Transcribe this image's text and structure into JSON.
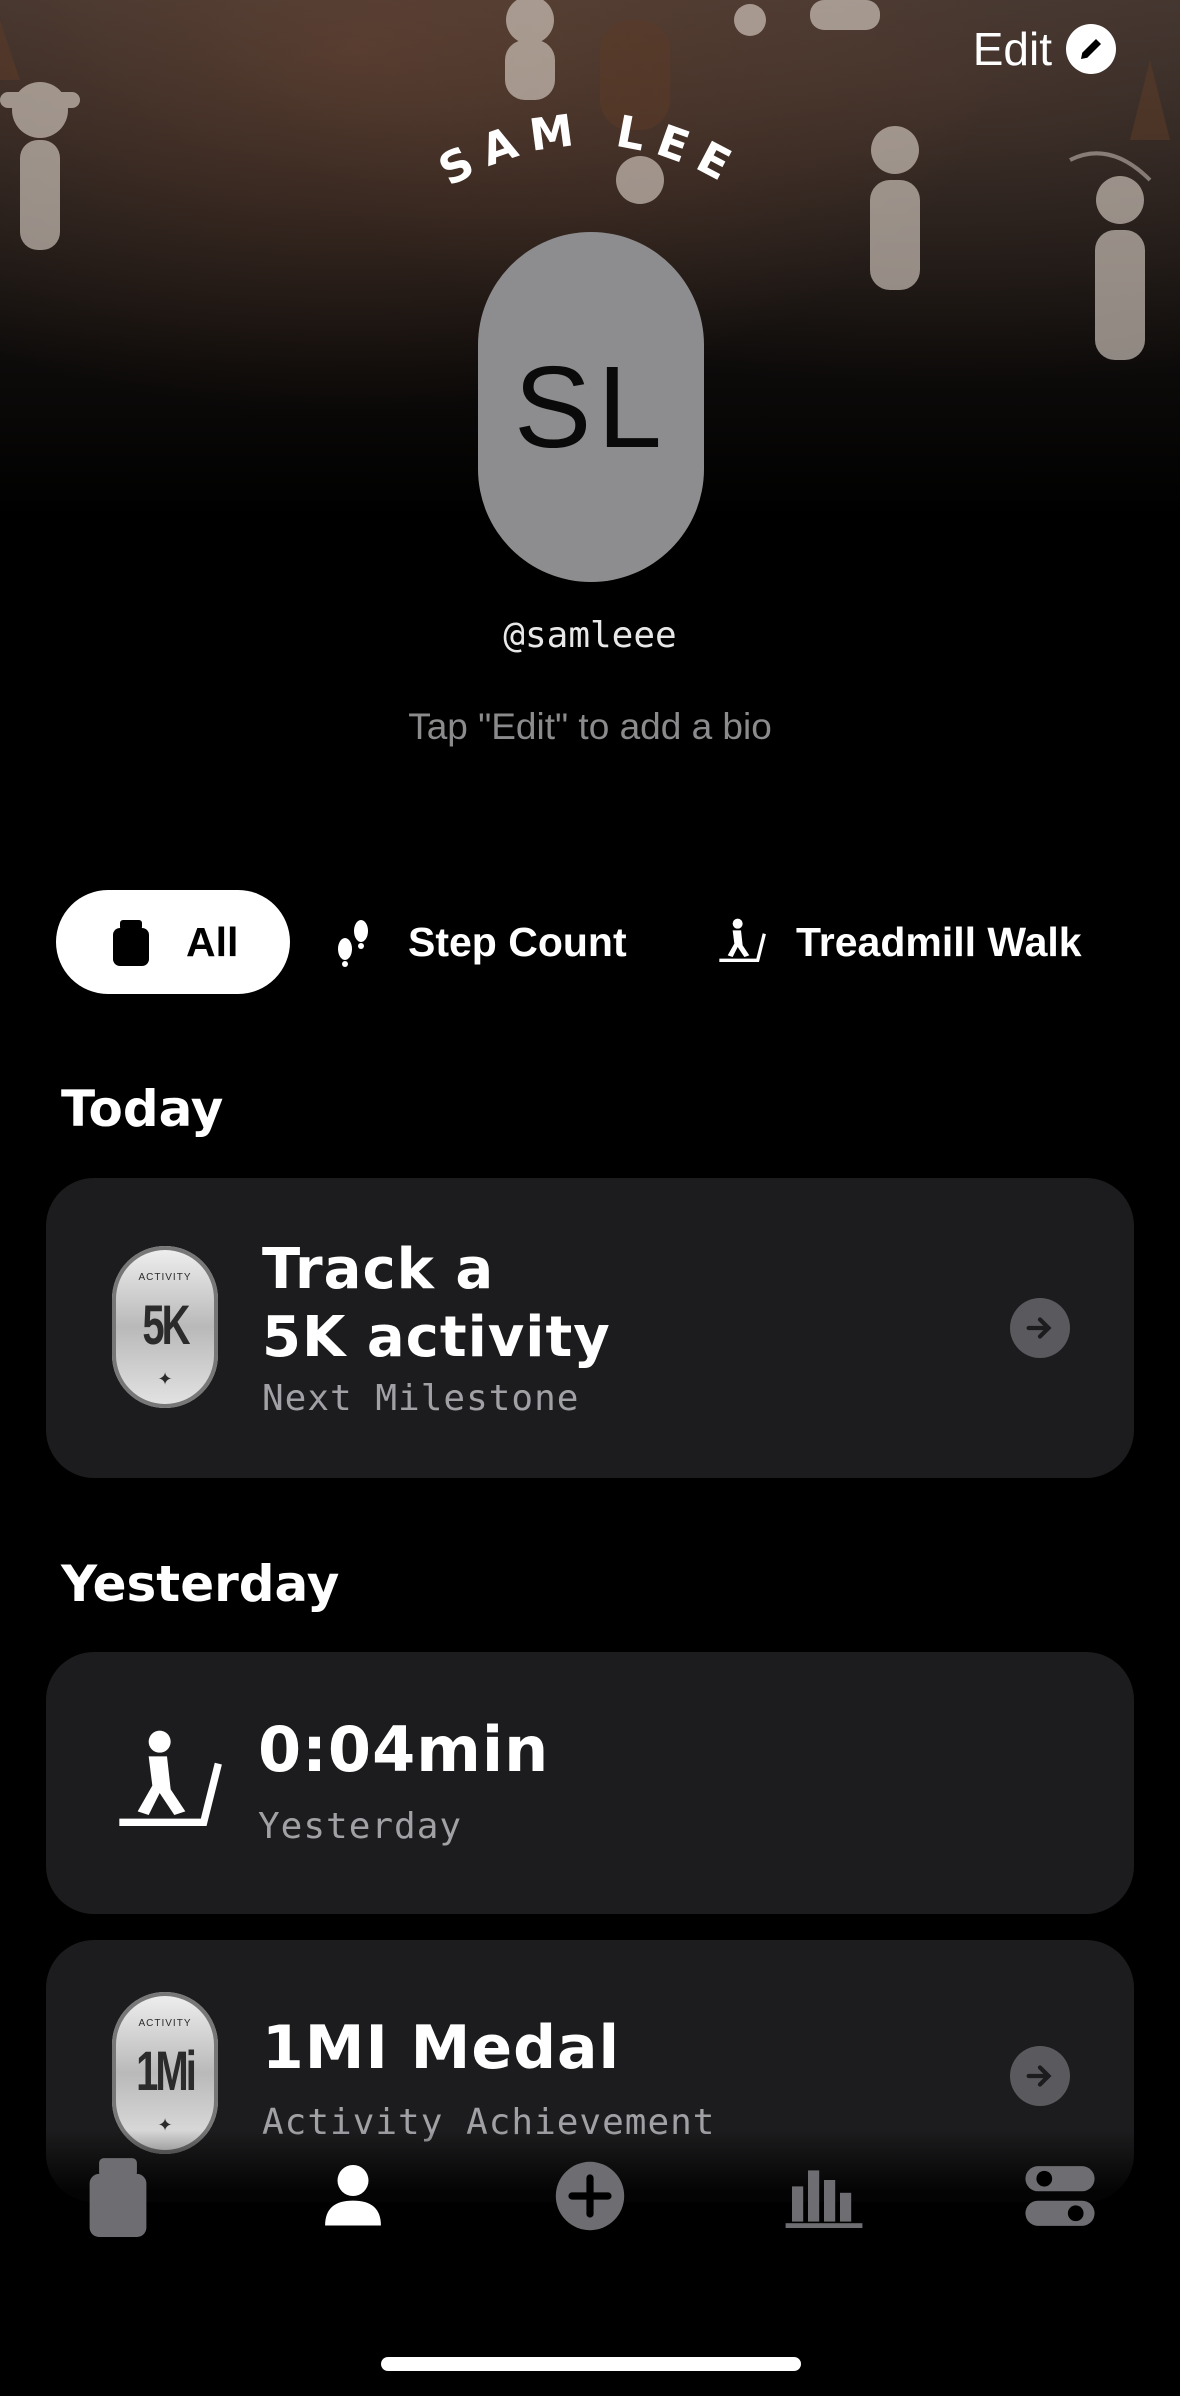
{
  "header": {
    "edit_label": "Edit",
    "name_arched": "SAM LEE",
    "avatar_initials": "SL",
    "handle": "@samleee",
    "bio_placeholder": "Tap \"Edit\" to add a bio"
  },
  "filters": [
    {
      "label": "All",
      "icon": "activity-icon",
      "active": true
    },
    {
      "label": "Step Count",
      "icon": "footsteps-icon",
      "active": false
    },
    {
      "label": "Treadmill Walk",
      "icon": "treadmill-icon",
      "active": false
    }
  ],
  "sections": {
    "today": {
      "title": "Today",
      "card": {
        "medal_top": "ACTIVITY",
        "medal_big": "5K",
        "title_line1": "Track a",
        "title_line2": "5K activity",
        "subtitle": "Next Milestone"
      }
    },
    "yesterday": {
      "title": "Yesterday",
      "cards": [
        {
          "icon": "treadmill-icon",
          "title": "0:04min",
          "subtitle": "Yesterday"
        },
        {
          "medal_top": "ACTIVITY",
          "medal_big": "1Mi",
          "title": "1MI Medal",
          "subtitle": "Activity Achievement"
        }
      ]
    }
  },
  "tabbar": [
    {
      "name": "feed-tab",
      "icon": "activity-icon",
      "active": false
    },
    {
      "name": "profile-tab",
      "icon": "person-icon",
      "active": true
    },
    {
      "name": "add-tab",
      "icon": "plus-circle-icon",
      "active": false
    },
    {
      "name": "stats-tab",
      "icon": "bar-chart-icon",
      "active": false
    },
    {
      "name": "settings-tab",
      "icon": "toggles-icon",
      "active": false
    }
  ],
  "colors": {
    "background": "#000000",
    "card": "#1c1c1e",
    "avatar": "#8d8d8f",
    "muted_text": "#8b8b8e",
    "active_chip": "#ffffff"
  }
}
